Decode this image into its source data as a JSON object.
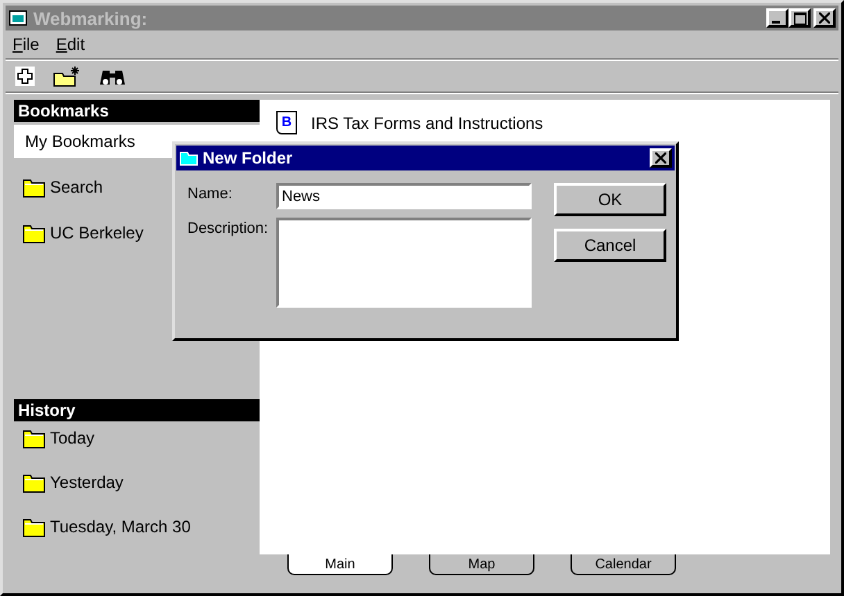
{
  "window": {
    "title": "Webmarking:"
  },
  "menu": [
    {
      "label": "File"
    },
    {
      "label": "Edit"
    }
  ],
  "toolbar": [
    {
      "kind": "add"
    },
    {
      "kind": "new-folder"
    },
    {
      "kind": "find"
    }
  ],
  "sidebar": [
    {
      "title": "Bookmarks",
      "items": [
        {
          "label": "My Bookmarks",
          "kind": "plain",
          "selected": true
        },
        {
          "label": "Search",
          "kind": "folder",
          "selected": false
        },
        {
          "label": "UC Berkeley",
          "kind": "folder",
          "selected": false
        }
      ]
    },
    {
      "title": "History",
      "items": [
        {
          "label": "Today",
          "kind": "folder",
          "selected": false
        },
        {
          "label": "Yesterday",
          "kind": "folder",
          "selected": false
        },
        {
          "label": "Tuesday, March 30",
          "kind": "folder",
          "selected": false
        }
      ]
    }
  ],
  "main": {
    "items": [
      {
        "icon_letter": "B",
        "label": "IRS Tax Forms and Instructions"
      }
    ]
  },
  "tabs": [
    {
      "label": "Main",
      "selected": true
    },
    {
      "label": "Map",
      "selected": false
    },
    {
      "label": "Calendar",
      "selected": false
    }
  ],
  "dialog": {
    "title": "New Folder",
    "name_label": "Name:",
    "name_value": "News",
    "description_label": "Description:",
    "buttons": [
      {
        "label": "OK"
      },
      {
        "label": "Cancel"
      }
    ]
  }
}
